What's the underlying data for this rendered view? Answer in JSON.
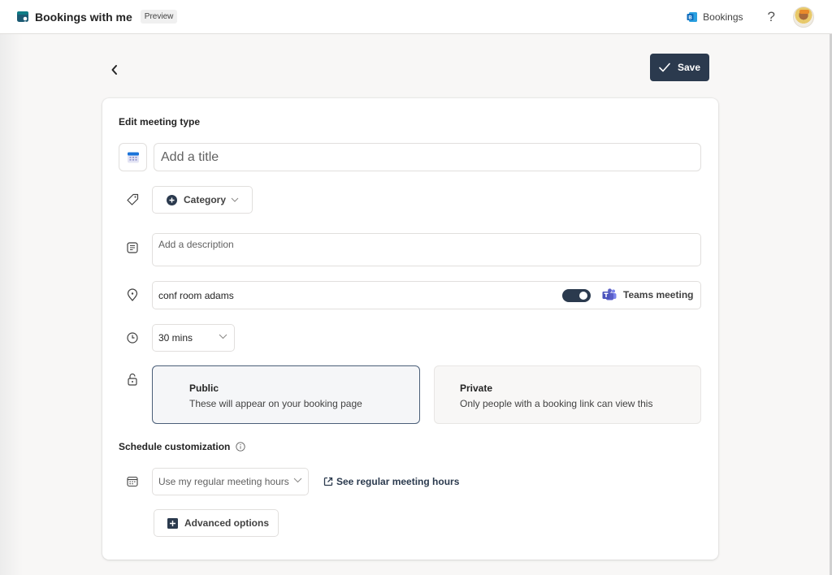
{
  "header": {
    "app_title": "Bookings with me",
    "badge": "Preview",
    "bookings_link": "Bookings",
    "help_label": "?",
    "avatar_alt": "User avatar"
  },
  "toolbar": {
    "back_icon": "chevron-left-icon",
    "save_label": "Save"
  },
  "form": {
    "section_title": "Edit meeting type",
    "title_placeholder": "Add a title",
    "title_value": "",
    "category_label": "Category",
    "description_placeholder": "Add a description",
    "description_value": "",
    "location_value": "conf room adams",
    "teams_toggle_on": true,
    "teams_label": "Teams meeting",
    "duration_selected": "30 mins",
    "visibility": {
      "selected": "public",
      "options": [
        {
          "id": "public",
          "title": "Public",
          "description": "These will appear on your booking page"
        },
        {
          "id": "private",
          "title": "Private",
          "description": "Only people with a booking link can view this"
        }
      ]
    },
    "schedule": {
      "title": "Schedule customization",
      "hours_selected": "Use my regular meeting hours",
      "see_hours_link": "See regular meeting hours"
    },
    "advanced_label": "Advanced options"
  },
  "colors": {
    "primary": "#2b3a4e",
    "teams": "#5b5fc7",
    "bookings_brand": "#0f6cbd"
  }
}
